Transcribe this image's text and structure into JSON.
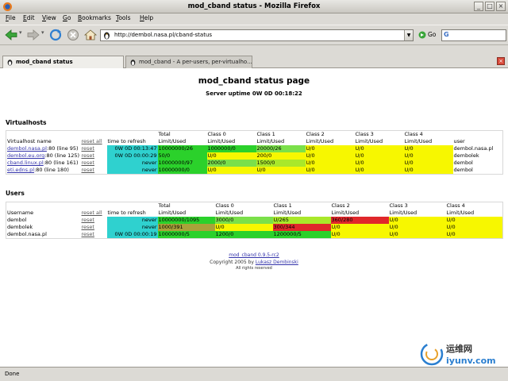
{
  "window": {
    "title": "mod_cband status - Mozilla Firefox"
  },
  "menu": [
    {
      "u": "F",
      "rest": "ile"
    },
    {
      "u": "E",
      "rest": "dit"
    },
    {
      "u": "V",
      "rest": "iew"
    },
    {
      "u": "G",
      "rest": "o"
    },
    {
      "u": "B",
      "rest": "ookmarks"
    },
    {
      "u": "T",
      "rest": "ools"
    },
    {
      "u": "H",
      "rest": "elp"
    }
  ],
  "toolbar": {
    "url": "http://dembol.nasa.pl/cband-status",
    "go_label": "Go",
    "search_engine_glyph": "G"
  },
  "tabs": [
    {
      "label": "mod_cband status",
      "active": true
    },
    {
      "label": "mod_cband - A per-users, per-virtualho...",
      "active": false
    }
  ],
  "page": {
    "title": "mod_cband status page",
    "uptime": "Server uptime 0W 0D 00:18:22",
    "virtualhosts_title": "Virtualhosts",
    "users_title": "Users",
    "footer_link": "mod_cband 0.9.5-rc2",
    "footer_copyright_prefix": "Copyright 2005 by ",
    "footer_author": "Lukasz Dembinski",
    "footer_rights": "All rights reserved"
  },
  "virtualhosts": {
    "headers": [
      "Virtualhost name",
      "reset all",
      "time to refresh",
      "Total\nLimit/Used",
      "Class 0\nLimit/Used",
      "Class 1\nLimit/Used",
      "Class 2\nLimit/Used",
      "Class 3\nLimit/Used",
      "Class 4\nLimit/Used",
      "user"
    ],
    "rows": [
      {
        "name": "dembol.nasa.pl",
        "line": ":80 (line 95)",
        "reset": "reset",
        "refresh": "0W 0D 00:13:47",
        "total": "10000000/26",
        "c0": "1000000/0",
        "c1": "20000/26",
        "c2": "U/0",
        "c3": "U/0",
        "c4": "U/0",
        "user": "dembol.nasa.pl",
        "colors": [
          "c-cyan",
          "c-green",
          "c-green",
          "c-lgreen",
          "c-yellow",
          "c-yellow",
          "c-yellow"
        ]
      },
      {
        "name": "dembol.eu.org",
        "line": ":80 (line 125)",
        "reset": "reset",
        "refresh": "0W 0D 00:00:29",
        "total": "50/0",
        "c0": "U/0",
        "c1": "200/0",
        "c2": "U/0",
        "c3": "U/0",
        "c4": "U/0",
        "user": "dembolek",
        "colors": [
          "c-cyan",
          "c-green",
          "c-yellow",
          "c-yellow",
          "c-yellow",
          "c-yellow",
          "c-yellow"
        ]
      },
      {
        "name": "cband.linux.pl",
        "line": ":80 (line 161)",
        "reset": "reset",
        "refresh": "never",
        "total": "10000000/97",
        "c0": "2000/0",
        "c1": "1500/0",
        "c2": "U/0",
        "c3": "U/0",
        "c4": "U/0",
        "user": "dembol",
        "colors": [
          "c-cyan",
          "c-green",
          "c-lgreen",
          "c-lime",
          "c-yellow",
          "c-yellow",
          "c-yellow"
        ]
      },
      {
        "name": "eti.edns.pl",
        "line": ":80 (line 180)",
        "reset": "reset",
        "refresh": "never",
        "total": "10000000/0",
        "c0": "U/0",
        "c1": "U/0",
        "c2": "U/0",
        "c3": "U/0",
        "c4": "U/0",
        "user": "dembol",
        "colors": [
          "c-cyan",
          "c-green",
          "c-yellow",
          "c-yellow",
          "c-yellow",
          "c-yellow",
          "c-yellow"
        ]
      }
    ]
  },
  "users": {
    "headers": [
      "Username",
      "reset all",
      "time to refresh",
      "Total\nLimit/Used",
      "Class 0\nLimit/Used",
      "Class 1\nLimit/Used",
      "Class 2\nLimit/Used",
      "Class 3\nLimit/Used",
      "Class 4\nLimit/Used"
    ],
    "rows": [
      {
        "name": "dembol",
        "reset": "reset",
        "refresh": "never",
        "total": "10000000/1095",
        "c0": "3000/0",
        "c1": "U/265",
        "c2": "360/280",
        "c3": "U/0",
        "c4": "U/0",
        "colors": [
          "c-cyan",
          "c-green",
          "c-lgreen",
          "c-lime",
          "c-red",
          "c-yellow",
          "c-yellow"
        ]
      },
      {
        "name": "dembolek",
        "reset": "reset",
        "refresh": "never",
        "total": "1000/391",
        "c0": "U/0",
        "c1": "300/344",
        "c2": "U/0",
        "c3": "U/0",
        "c4": "U/0",
        "colors": [
          "c-cyan",
          "c-olive",
          "c-yellow",
          "c-red",
          "c-yellow",
          "c-yellow",
          "c-yellow"
        ]
      },
      {
        "name": "dembol.nasa.pl",
        "reset": "reset",
        "refresh": "0W 0D 00:00:19",
        "total": "10000000/5",
        "c0": "1200/0",
        "c1": "1200000/5",
        "c2": "U/0",
        "c3": "U/0",
        "c4": "U/0",
        "colors": [
          "c-cyan",
          "c-green",
          "c-green",
          "c-green",
          "c-yellow",
          "c-yellow",
          "c-yellow"
        ]
      }
    ]
  },
  "statusbar": {
    "text": "Done"
  },
  "watermark": {
    "text": "运维网",
    "url": "iyunv.com"
  },
  "colors": {
    "cyan": "#2fd1cf",
    "green": "#2bd12b",
    "yellow": "#f7f700",
    "red": "#e0272b"
  }
}
